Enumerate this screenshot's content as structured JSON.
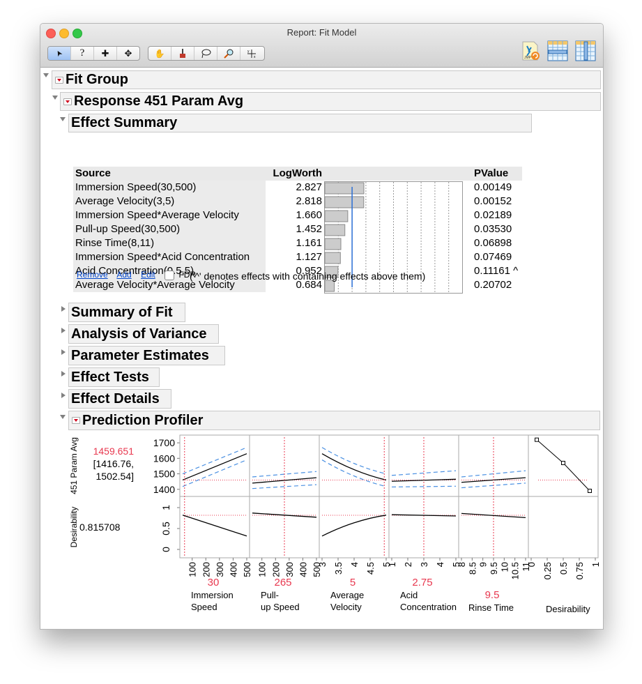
{
  "window": {
    "title": "Report: Fit Model"
  },
  "toolbar": {
    "group1": [
      {
        "icon": "arrow-pointer-icon",
        "glyph": "➤",
        "active": true
      },
      {
        "icon": "help-question-icon",
        "glyph": "?"
      },
      {
        "icon": "crosshair-select-icon",
        "glyph": "✚"
      },
      {
        "icon": "move-icon",
        "glyph": "✥"
      }
    ],
    "group2": [
      {
        "icon": "hand-grabber-icon",
        "glyph": "✋"
      },
      {
        "icon": "brush-icon",
        "glyph": "🖌"
      },
      {
        "icon": "lasso-icon",
        "glyph": "◌"
      },
      {
        "icon": "magnifier-icon",
        "glyph": "⚲"
      },
      {
        "icon": "crosshairs-xy-icon",
        "glyph": "✛"
      }
    ],
    "right_icons": [
      "jmp-script-icon",
      "data-table-row-icon",
      "data-table-column-icon"
    ]
  },
  "outline": {
    "fit_group": "Fit Group",
    "response": "Response 451 Param Avg",
    "effect_summary": "Effect Summary",
    "summary_of_fit": "Summary of Fit",
    "analysis_of_variance": "Analysis of Variance",
    "parameter_estimates": "Parameter Estimates",
    "effect_tests": "Effect Tests",
    "effect_details": "Effect Details",
    "prediction_profiler": "Prediction Profiler"
  },
  "effect_summary": {
    "headers": {
      "source": "Source",
      "logworth": "LogWorth",
      "pvalue": "PValue"
    },
    "rows": [
      {
        "source": "Immersion Speed(30,500)",
        "logworth": "2.827",
        "pvalue": "0.00149",
        "flag": ""
      },
      {
        "source": "Average Velocity(3,5)",
        "logworth": "2.818",
        "pvalue": "0.00152",
        "flag": ""
      },
      {
        "source": "Immersion Speed*Average Velocity",
        "logworth": "1.660",
        "pvalue": "0.02189",
        "flag": ""
      },
      {
        "source": "Pull-up Speed(30,500)",
        "logworth": "1.452",
        "pvalue": "0.03530",
        "flag": ""
      },
      {
        "source": "Rinse Time(8,11)",
        "logworth": "1.161",
        "pvalue": "0.06898",
        "flag": ""
      },
      {
        "source": "Immersion Speed*Acid Concentration",
        "logworth": "1.127",
        "pvalue": "0.07469",
        "flag": ""
      },
      {
        "source": "Acid Concentration(0.5,5)",
        "logworth": "0.952",
        "pvalue": "0.11161",
        "flag": "^"
      },
      {
        "source": "Average Velocity*Average Velocity",
        "logworth": "0.684",
        "pvalue": "0.20702",
        "flag": ""
      }
    ],
    "significance_line_logworth": 2,
    "bar_axis_max": 10,
    "links": {
      "remove": "Remove",
      "add": "Add",
      "edit": "Edit"
    },
    "fdr_label": "FDR",
    "fdr_checked": false,
    "note": "('^' denotes effects with containing effects above them)"
  },
  "profiler": {
    "response_label": "451 Param Avg",
    "response_value": "1459.651",
    "response_ci": "[1416.76, 1502.54]",
    "desirability_label": "Desirability",
    "desirability_value": "0.815708",
    "y_ticks_response": [
      "1700",
      "1600",
      "1500",
      "1400"
    ],
    "y_ticks_desirability": [
      "1",
      "0.5",
      "0"
    ],
    "factors": [
      {
        "name": "Immersion Speed",
        "value": "30",
        "ticks": [
          "100",
          "200",
          "300",
          "400",
          "500"
        ]
      },
      {
        "name": "Pull-up Speed",
        "value": "265",
        "ticks": [
          "100",
          "200",
          "300",
          "400",
          "500"
        ]
      },
      {
        "name": "Average Velocity",
        "value": "5",
        "ticks": [
          "3",
          "3.5",
          "4",
          "4.5",
          "5"
        ]
      },
      {
        "name": "Acid Concentration",
        "value": "2.75",
        "ticks": [
          "1",
          "2",
          "3",
          "4",
          "5"
        ]
      },
      {
        "name": "Rinse Time",
        "value": "9.5",
        "ticks": [
          "8",
          "8.5",
          "9",
          "9.5",
          "10",
          "10.5",
          "11"
        ]
      },
      {
        "name": "Desirability",
        "value": "",
        "ticks": [
          "0",
          "0.25",
          "0.5",
          "0.75",
          "1"
        ]
      }
    ],
    "colors": {
      "current": "#e8384f",
      "ci": "#4a90e2",
      "curve": "#000000"
    }
  }
}
